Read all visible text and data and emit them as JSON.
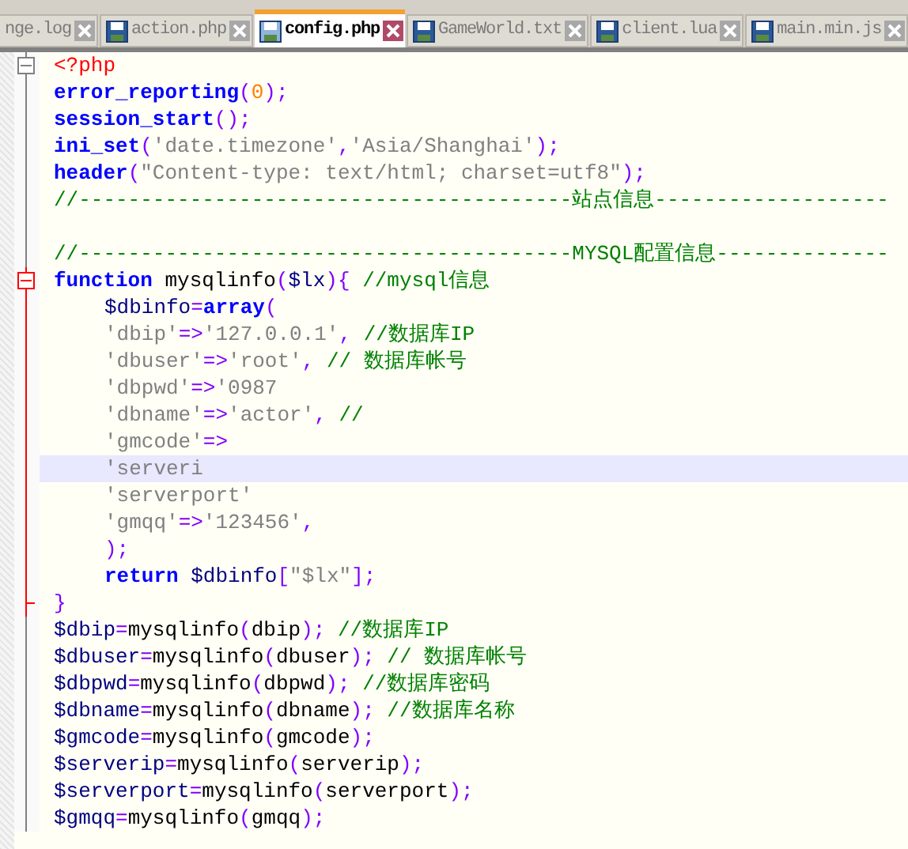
{
  "tabs": [
    {
      "label": "nge.log",
      "kind": "partial",
      "selected": false
    },
    {
      "label": "action.php",
      "kind": "file",
      "selected": false
    },
    {
      "label": "config.php",
      "kind": "file",
      "selected": true
    },
    {
      "label": "GameWorld.txt",
      "kind": "file",
      "selected": false
    },
    {
      "label": "client.lua",
      "kind": "file",
      "selected": false
    },
    {
      "label": "main.min.js",
      "kind": "file",
      "selected": false
    }
  ],
  "editor": {
    "lines": [
      {
        "kind": "fold-start",
        "tokens": [
          {
            "kind": "tag",
            "text": "<?php"
          }
        ]
      },
      {
        "tokens": [
          {
            "kind": "kw",
            "text": "error_reporting"
          },
          {
            "kind": "op",
            "text": "("
          },
          {
            "kind": "num",
            "text": "0"
          },
          {
            "kind": "op",
            "text": ");"
          }
        ]
      },
      {
        "tokens": [
          {
            "kind": "kw",
            "text": "session_start"
          },
          {
            "kind": "op",
            "text": "();"
          }
        ]
      },
      {
        "tokens": [
          {
            "kind": "kw",
            "text": "ini_set"
          },
          {
            "kind": "op",
            "text": "("
          },
          {
            "kind": "str",
            "text": "'date.timezone'"
          },
          {
            "kind": "op",
            "text": ","
          },
          {
            "kind": "str",
            "text": "'Asia/Shanghai'"
          },
          {
            "kind": "op",
            "text": ");"
          }
        ]
      },
      {
        "tokens": [
          {
            "kind": "kw",
            "text": "header"
          },
          {
            "kind": "op",
            "text": "("
          },
          {
            "kind": "str",
            "text": "\"Content-type: text/html; charset=utf8\""
          },
          {
            "kind": "op",
            "text": ");"
          }
        ]
      },
      {
        "tokens": [
          {
            "kind": "cmt",
            "text": "//----------------------------------------站点信息-------------------"
          }
        ]
      },
      {
        "kind": "plain"
      },
      {
        "tokens": [
          {
            "kind": "cmt",
            "text": "//----------------------------------------MYSQL配置信息--------------"
          }
        ]
      },
      {
        "kind": "fold-start",
        "tokens": [
          {
            "kind": "kw",
            "text": "function"
          },
          {
            "kind": "txt",
            "text": " mysqlinfo"
          },
          {
            "kind": "op",
            "text": "("
          },
          {
            "kind": "var",
            "text": "$lx"
          },
          {
            "kind": "op",
            "text": "){"
          },
          {
            "kind": "cmt",
            "text": " //mysql信息"
          }
        ]
      },
      {
        "indent": true,
        "tokens": [
          {
            "kind": "var",
            "text": "$dbinfo"
          },
          {
            "kind": "op",
            "text": "="
          },
          {
            "kind": "kw",
            "text": "array"
          },
          {
            "kind": "op",
            "text": "("
          }
        ]
      },
      {
        "indent": true,
        "tokens": [
          {
            "kind": "str",
            "text": "'dbip'"
          },
          {
            "kind": "op",
            "text": "=>"
          },
          {
            "kind": "str",
            "text": "'127.0.0.1'"
          },
          {
            "kind": "op",
            "text": ","
          },
          {
            "kind": "cmt",
            "text": " //数据库IP"
          }
        ]
      },
      {
        "indent": true,
        "tokens": [
          {
            "kind": "str",
            "text": "'dbuser'"
          },
          {
            "kind": "op",
            "text": "=>"
          },
          {
            "kind": "str",
            "text": "'root'"
          },
          {
            "kind": "op",
            "text": ","
          },
          {
            "kind": "cmt",
            "text": " // 数据库帐号"
          }
        ]
      },
      {
        "indent": true,
        "tokens": [
          {
            "kind": "str",
            "text": "'dbpwd'"
          },
          {
            "kind": "op",
            "text": "=>"
          },
          {
            "kind": "str",
            "text": "'0987"
          }
        ]
      },
      {
        "indent": true,
        "tokens": [
          {
            "kind": "str",
            "text": "'dbname'"
          },
          {
            "kind": "op",
            "text": "=>"
          },
          {
            "kind": "str",
            "text": "'actor'"
          },
          {
            "kind": "op",
            "text": ","
          },
          {
            "kind": "cmt",
            "text": " //"
          }
        ]
      },
      {
        "indent": true,
        "tokens": [
          {
            "kind": "str",
            "text": "'gmcode'"
          },
          {
            "kind": "op",
            "text": "=>"
          }
        ]
      },
      {
        "indent": true,
        "current": true,
        "tokens": [
          {
            "kind": "str",
            "text": "'serveri"
          }
        ]
      },
      {
        "indent": true,
        "tokens": [
          {
            "kind": "str",
            "text": "'serverport'"
          }
        ]
      },
      {
        "indent": true,
        "tokens": [
          {
            "kind": "str",
            "text": "'gmqq'"
          },
          {
            "kind": "op",
            "text": "=>"
          },
          {
            "kind": "str",
            "text": "'123456'"
          },
          {
            "kind": "op",
            "text": ","
          }
        ]
      },
      {
        "indent": true,
        "tokens": [
          {
            "kind": "op",
            "text": ");"
          }
        ]
      },
      {
        "indent": true,
        "tokens": [
          {
            "kind": "kw",
            "text": "return"
          },
          {
            "kind": "var",
            "text": " $dbinfo"
          },
          {
            "kind": "op",
            "text": "["
          },
          {
            "kind": "str",
            "text": "\"$lx\""
          },
          {
            "kind": "op",
            "text": "];"
          }
        ]
      },
      {
        "kind": "fold-end",
        "tokens": [
          {
            "kind": "op",
            "text": "}"
          }
        ]
      },
      {
        "tokens": [
          {
            "kind": "var",
            "text": "$dbip"
          },
          {
            "kind": "op",
            "text": "="
          },
          {
            "kind": "txt",
            "text": "mysqlinfo"
          },
          {
            "kind": "op",
            "text": "("
          },
          {
            "kind": "txt",
            "text": "dbip"
          },
          {
            "kind": "op",
            "text": ");"
          },
          {
            "kind": "cmt",
            "text": " //数据库IP"
          }
        ]
      },
      {
        "tokens": [
          {
            "kind": "var",
            "text": "$dbuser"
          },
          {
            "kind": "op",
            "text": "="
          },
          {
            "kind": "txt",
            "text": "mysqlinfo"
          },
          {
            "kind": "op",
            "text": "("
          },
          {
            "kind": "txt",
            "text": "dbuser"
          },
          {
            "kind": "op",
            "text": ");"
          },
          {
            "kind": "cmt",
            "text": " // 数据库帐号"
          }
        ]
      },
      {
        "tokens": [
          {
            "kind": "var",
            "text": "$dbpwd"
          },
          {
            "kind": "op",
            "text": "="
          },
          {
            "kind": "txt",
            "text": "mysqlinfo"
          },
          {
            "kind": "op",
            "text": "("
          },
          {
            "kind": "txt",
            "text": "dbpwd"
          },
          {
            "kind": "op",
            "text": ");"
          },
          {
            "kind": "cmt",
            "text": " //数据库密码"
          }
        ]
      },
      {
        "tokens": [
          {
            "kind": "var",
            "text": "$dbname"
          },
          {
            "kind": "op",
            "text": "="
          },
          {
            "kind": "txt",
            "text": "mysqlinfo"
          },
          {
            "kind": "op",
            "text": "("
          },
          {
            "kind": "txt",
            "text": "dbname"
          },
          {
            "kind": "op",
            "text": ");"
          },
          {
            "kind": "cmt",
            "text": " //数据库名称"
          }
        ]
      },
      {
        "tokens": [
          {
            "kind": "var",
            "text": "$gmcode"
          },
          {
            "kind": "op",
            "text": "="
          },
          {
            "kind": "txt",
            "text": "mysqlinfo"
          },
          {
            "kind": "op",
            "text": "("
          },
          {
            "kind": "txt",
            "text": "gmcode"
          },
          {
            "kind": "op",
            "text": ");"
          }
        ]
      },
      {
        "tokens": [
          {
            "kind": "var",
            "text": "$serverip"
          },
          {
            "kind": "op",
            "text": "="
          },
          {
            "kind": "txt",
            "text": "mysqlinfo"
          },
          {
            "kind": "op",
            "text": "("
          },
          {
            "kind": "txt",
            "text": "serverip"
          },
          {
            "kind": "op",
            "text": ");"
          }
        ]
      },
      {
        "tokens": [
          {
            "kind": "var",
            "text": "$serverport"
          },
          {
            "kind": "op",
            "text": "="
          },
          {
            "kind": "txt",
            "text": "mysqlinfo"
          },
          {
            "kind": "op",
            "text": "("
          },
          {
            "kind": "txt",
            "text": "serverport"
          },
          {
            "kind": "op",
            "text": ");"
          }
        ]
      },
      {
        "tokens": [
          {
            "kind": "var",
            "text": "$gmqq"
          },
          {
            "kind": "op",
            "text": "="
          },
          {
            "kind": "txt",
            "text": "mysqlinfo"
          },
          {
            "kind": "op",
            "text": "("
          },
          {
            "kind": "txt",
            "text": "gmqq"
          },
          {
            "kind": "op",
            "text": ");"
          }
        ]
      }
    ]
  }
}
